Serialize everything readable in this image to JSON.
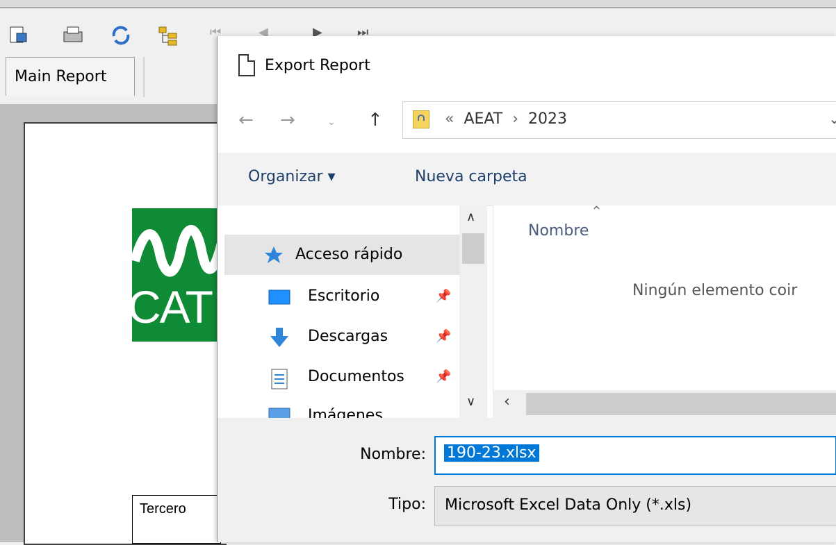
{
  "app": {
    "tab_main_report": "Main Report",
    "report_logo_text": "CAT",
    "report_field_label": "Tercero"
  },
  "dialog": {
    "title": "Export Report",
    "breadcrumb": {
      "overflow": "«",
      "folder1": "AEAT",
      "separator": "›",
      "folder2": "2023"
    },
    "commands": {
      "organize": "Organizar ▾",
      "new_folder": "Nueva carpeta"
    },
    "nav_items": [
      {
        "label": "Acceso rápido"
      },
      {
        "label": "Escritorio"
      },
      {
        "label": "Descargas"
      },
      {
        "label": "Documentos"
      },
      {
        "label": "Imágenes"
      }
    ],
    "list": {
      "column_name": "Nombre",
      "empty_message": "Ningún elemento coir"
    },
    "footer": {
      "name_label": "Nombre:",
      "name_value": "190-23.xlsx",
      "type_label": "Tipo:",
      "type_value": "Microsoft Excel Data Only (*.xls)"
    }
  },
  "colors": {
    "accent": "#0078d7",
    "logo_green": "#0f8a35",
    "selection": "#e5e5e5"
  }
}
